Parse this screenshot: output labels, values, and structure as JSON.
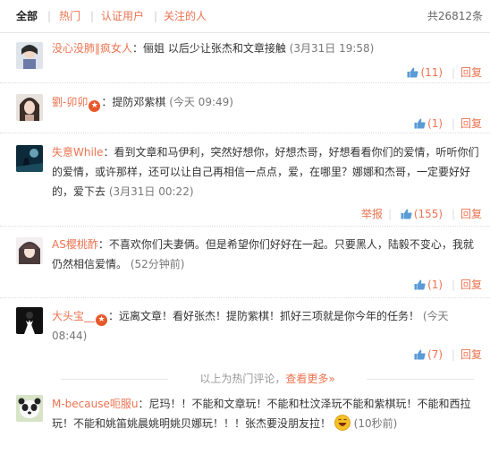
{
  "tabs": {
    "all": "全部",
    "hot": "热门",
    "verified": "认证用户",
    "following": "关注的人",
    "sep": "|",
    "total": "共26812条"
  },
  "actions": {
    "reply": "回复",
    "report": "举报"
  },
  "comments": [
    {
      "user": "没心没肺‖疯女人",
      "text": "：俪姐 以后少让张杰和文章接触",
      "time": "(3月31日 19:58)",
      "likes": "(11)"
    },
    {
      "user": "劉-卯卯",
      "text": "：提防邓紫棋",
      "time": "(今天 09:49)",
      "likes": "(1)",
      "badge": "★"
    },
    {
      "user": "失意While",
      "text": "：看到文章和马伊利，突然好想你，好想杰哥，好想看看你们的爱情，听听你们的爱情，或许那样，还可以让自己再相信一点点，爱，在哪里？娜娜和杰哥，一定要好好的，爱下去",
      "time": "(3月31日 00:22)",
      "likes": "(155)"
    },
    {
      "user": "AS樱桃酢",
      "text": "：不喜欢你们夫妻俩。但是希望你们好好在一起。只要黑人，陆毅不变心，我就仍然相信爱情。",
      "time": "(52分钟前)",
      "likes": "(1)"
    },
    {
      "user": "大头宝__",
      "text": "：远离文章！看好张杰！提防紫棋！抓好三项就是你今年的任务！",
      "time": "(今天 08:44)",
      "likes": "(7)",
      "badge": "★"
    },
    {
      "user": "M-because呃服u",
      "text": "：尼玛！！不能和文章玩！不能和杜汶泽玩不能和紫棋玩！不能和西拉玩！不能和姚笛姚晨姚明姚贝娜玩！！！张杰要没朋友拉！",
      "time": "(10秒前)"
    }
  ],
  "hotline": {
    "text": "以上为热门评论，",
    "more": "查看更多»"
  }
}
